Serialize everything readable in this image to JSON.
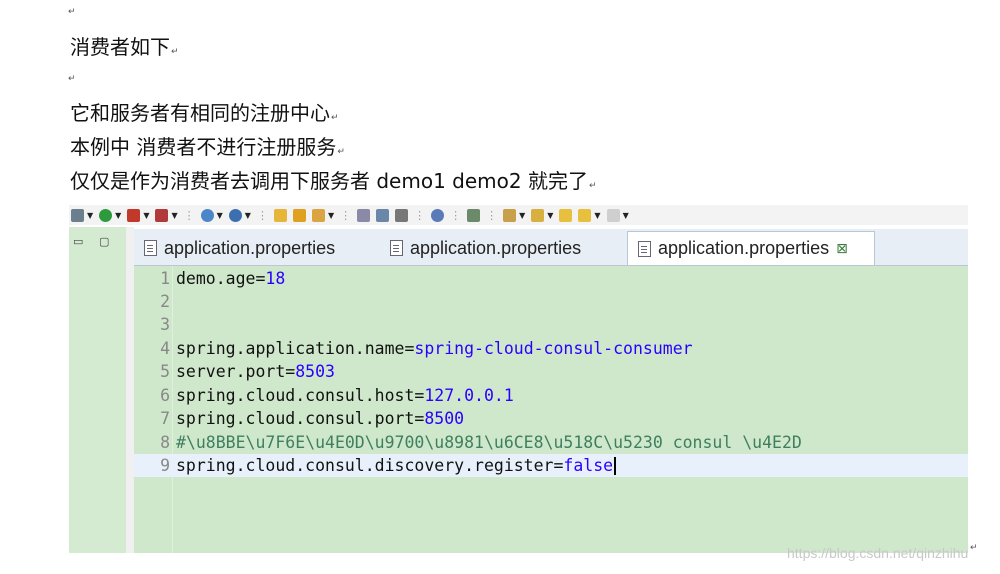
{
  "document": {
    "pilcrow": "↵",
    "lines": [
      "消费者如下",
      "它和服务者有相同的注册中心",
      "本例中 消费者不进行注册服务",
      "仅仅是作为消费者去调用下服务者 demo1 demo2 就完了"
    ]
  },
  "ide": {
    "tabs": [
      {
        "label": "application.properties",
        "active": false
      },
      {
        "label": "application.properties",
        "active": false
      },
      {
        "label": "application.properties",
        "active": true,
        "close_icon": "⊠"
      }
    ],
    "left_pane_controls": [
      "▭",
      "▢"
    ],
    "code_lines": [
      {
        "num": "1",
        "key": "demo.age=",
        "value": "18"
      },
      {
        "num": "2",
        "key": "",
        "value": ""
      },
      {
        "num": "3",
        "key": "",
        "value": ""
      },
      {
        "num": "4",
        "key": "spring.application.name=",
        "value": "spring-cloud-consul-consumer"
      },
      {
        "num": "5",
        "key": "server.port=",
        "value": "8503"
      },
      {
        "num": "6",
        "key": "spring.cloud.consul.host=",
        "value": "127.0.0.1"
      },
      {
        "num": "7",
        "key": "spring.cloud.consul.port=",
        "value": "8500"
      },
      {
        "num": "8",
        "comment": "#\\u8BBE\\u7F6E\\u4E0D\\u9700\\u8981\\u6CE8\\u518C\\u5230 consul \\u4E2D"
      },
      {
        "num": "9",
        "key": "spring.cloud.consul.discovery.register=",
        "value": "false"
      }
    ]
  },
  "watermark": "https://blog.csdn.net/qinzhihu",
  "colors": {
    "editor_bg": "#cfe8cb",
    "value_text": "#2a00ff",
    "comment_text": "#3f7f5f",
    "current_line": "#e8f1fb"
  }
}
